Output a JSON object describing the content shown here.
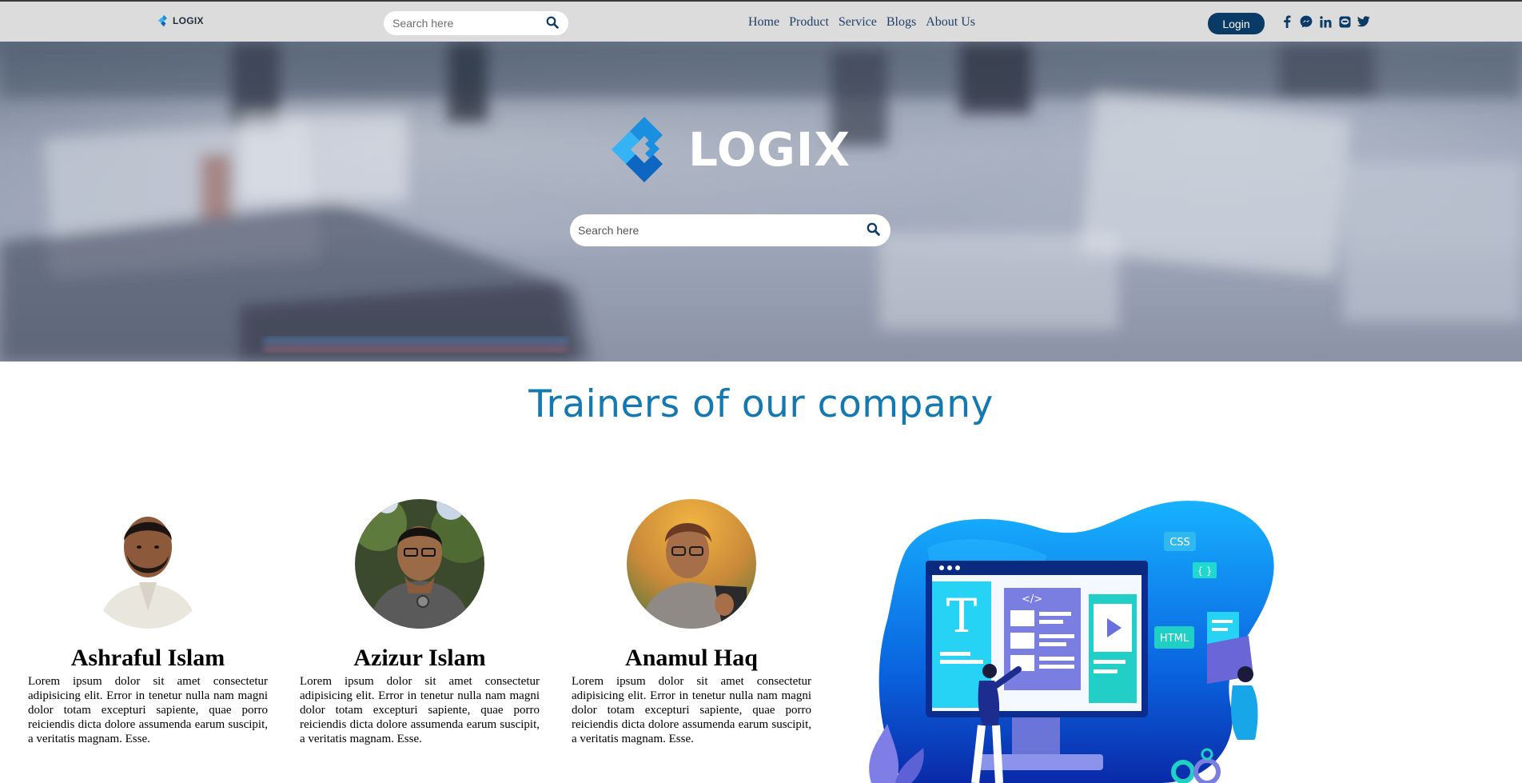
{
  "brand": {
    "name": "LOGIX"
  },
  "nav": {
    "search_placeholder": "Search here",
    "links": [
      {
        "label": "Home"
      },
      {
        "label": "Product"
      },
      {
        "label": "Service"
      },
      {
        "label": "Blogs"
      },
      {
        "label": "About Us"
      }
    ],
    "login_label": "Login",
    "socials": [
      "facebook-icon",
      "messenger-icon",
      "linkedin-icon",
      "line-icon",
      "twitter-icon"
    ]
  },
  "hero": {
    "logo_text": "LOGIX",
    "search_placeholder": "Search here"
  },
  "trainers_section": {
    "title": "Trainers of our company",
    "trainers": [
      {
        "name": "Ashraful Islam",
        "bio": "Lorem ipsum dolor sit amet consectetur adipisicing elit. Error in tenetur nulla nam magni dolor totam excepturi sapiente, quae porro reiciendis dicta dolore assumenda earum suscipit, a veritatis magnam. Esse."
      },
      {
        "name": "Azizur Islam",
        "bio": "Lorem ipsum dolor sit amet consectetur adipisicing elit. Error in tenetur nulla nam magni dolor totam excepturi sapiente, quae porro reiciendis dicta dolore assumenda earum suscipit, a veritatis magnam. Esse."
      },
      {
        "name": "Anamul Haq",
        "bio": "Lorem ipsum dolor sit amet consectetur adipisicing elit. Error in tenetur nulla nam magni dolor totam excepturi sapiente, quae porro reiciendis dicta dolore assumenda earum suscipit, a veritatis magnam. Esse."
      }
    ],
    "illustration_labels": {
      "css": "CSS",
      "html": "HTML",
      "braces": "{ }",
      "code": "</>",
      "text_block": "T"
    }
  },
  "colors": {
    "nav_bg": "#dcdcdc",
    "nav_link": "#1f3f66",
    "login_bg": "#0a3a66",
    "title": "#1479b0",
    "logo_blue": "#1a8fe0"
  }
}
